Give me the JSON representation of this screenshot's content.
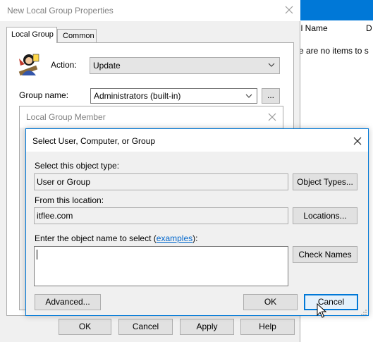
{
  "background_window": {
    "column_name": "ll Name",
    "column_d": "D",
    "empty_message": "e are no items to s"
  },
  "props_dialog": {
    "title": "New Local Group Properties",
    "tabs": [
      {
        "label": "Local Group",
        "active": true
      },
      {
        "label": "Common",
        "active": false
      }
    ],
    "action_label": "Action:",
    "action_value": "Update",
    "group_name_label": "Group name:",
    "group_name_value": "Administrators (built-in)",
    "browse_label": "...",
    "buttons": {
      "ok": "OK",
      "cancel": "Cancel",
      "apply": "Apply",
      "help": "Help"
    }
  },
  "member_dialog": {
    "title": "Local Group Member"
  },
  "select_dialog": {
    "title": "Select User, Computer, or Group",
    "object_type_label": "Select this object type:",
    "object_type_value": "User or Group",
    "object_types_button": "Object Types...",
    "location_label": "From this location:",
    "location_value": "itflee.com",
    "locations_button": "Locations...",
    "enter_label_prefix": "Enter the object name to select (",
    "enter_label_link": "examples",
    "enter_label_suffix": "):",
    "object_name_value": "",
    "check_names_button": "Check Names",
    "advanced_button": "Advanced...",
    "ok_button": "OK",
    "cancel_button": "Cancel"
  },
  "colors": {
    "accent": "#0078d7",
    "link": "#0066cc",
    "dialog_bg": "#f0f0f0",
    "button_bg": "#e1e1e1",
    "button_border": "#adadad"
  }
}
